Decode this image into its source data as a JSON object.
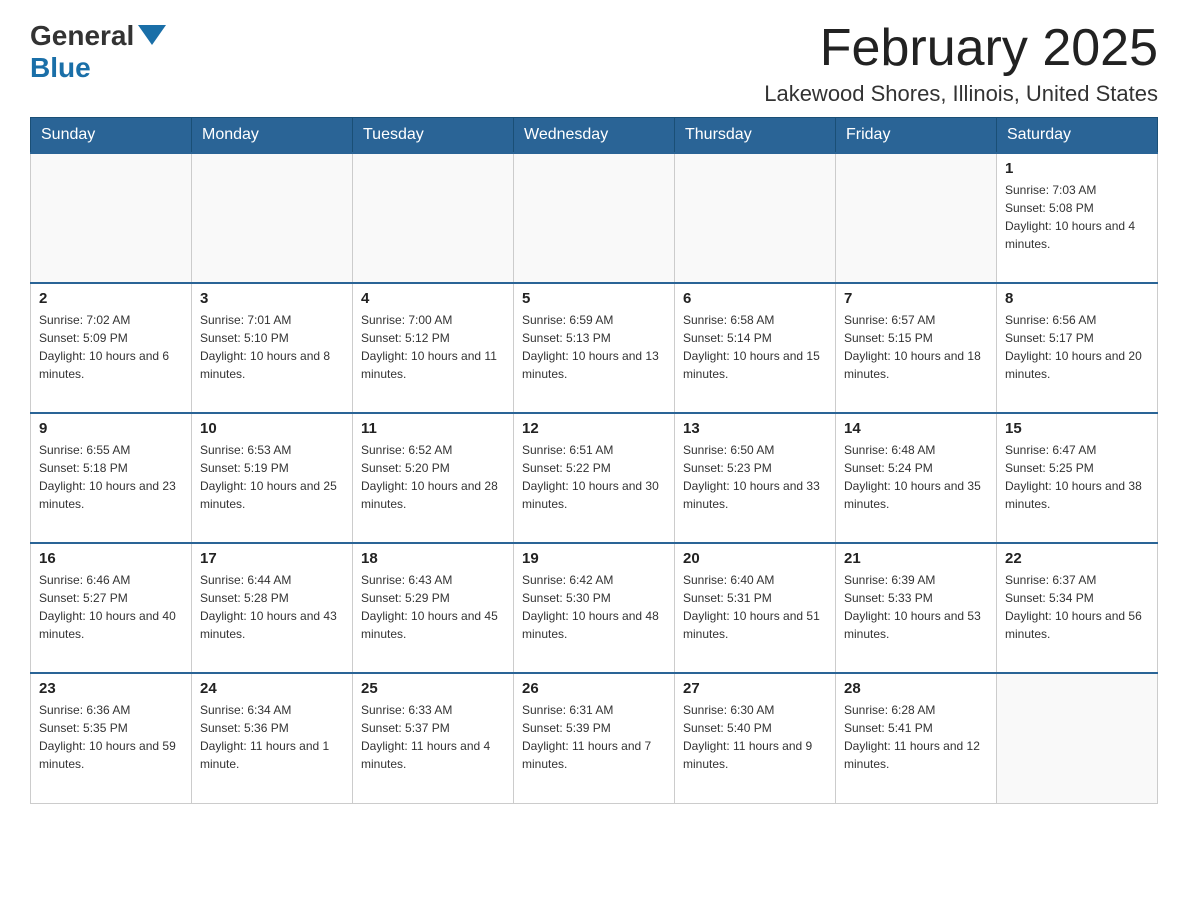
{
  "logo": {
    "text_general": "General",
    "text_blue": "Blue"
  },
  "title": "February 2025",
  "location": "Lakewood Shores, Illinois, United States",
  "days_of_week": [
    "Sunday",
    "Monday",
    "Tuesday",
    "Wednesday",
    "Thursday",
    "Friday",
    "Saturday"
  ],
  "weeks": [
    [
      {
        "day": "",
        "info": ""
      },
      {
        "day": "",
        "info": ""
      },
      {
        "day": "",
        "info": ""
      },
      {
        "day": "",
        "info": ""
      },
      {
        "day": "",
        "info": ""
      },
      {
        "day": "",
        "info": ""
      },
      {
        "day": "1",
        "info": "Sunrise: 7:03 AM\nSunset: 5:08 PM\nDaylight: 10 hours and 4 minutes."
      }
    ],
    [
      {
        "day": "2",
        "info": "Sunrise: 7:02 AM\nSunset: 5:09 PM\nDaylight: 10 hours and 6 minutes."
      },
      {
        "day": "3",
        "info": "Sunrise: 7:01 AM\nSunset: 5:10 PM\nDaylight: 10 hours and 8 minutes."
      },
      {
        "day": "4",
        "info": "Sunrise: 7:00 AM\nSunset: 5:12 PM\nDaylight: 10 hours and 11 minutes."
      },
      {
        "day": "5",
        "info": "Sunrise: 6:59 AM\nSunset: 5:13 PM\nDaylight: 10 hours and 13 minutes."
      },
      {
        "day": "6",
        "info": "Sunrise: 6:58 AM\nSunset: 5:14 PM\nDaylight: 10 hours and 15 minutes."
      },
      {
        "day": "7",
        "info": "Sunrise: 6:57 AM\nSunset: 5:15 PM\nDaylight: 10 hours and 18 minutes."
      },
      {
        "day": "8",
        "info": "Sunrise: 6:56 AM\nSunset: 5:17 PM\nDaylight: 10 hours and 20 minutes."
      }
    ],
    [
      {
        "day": "9",
        "info": "Sunrise: 6:55 AM\nSunset: 5:18 PM\nDaylight: 10 hours and 23 minutes."
      },
      {
        "day": "10",
        "info": "Sunrise: 6:53 AM\nSunset: 5:19 PM\nDaylight: 10 hours and 25 minutes."
      },
      {
        "day": "11",
        "info": "Sunrise: 6:52 AM\nSunset: 5:20 PM\nDaylight: 10 hours and 28 minutes."
      },
      {
        "day": "12",
        "info": "Sunrise: 6:51 AM\nSunset: 5:22 PM\nDaylight: 10 hours and 30 minutes."
      },
      {
        "day": "13",
        "info": "Sunrise: 6:50 AM\nSunset: 5:23 PM\nDaylight: 10 hours and 33 minutes."
      },
      {
        "day": "14",
        "info": "Sunrise: 6:48 AM\nSunset: 5:24 PM\nDaylight: 10 hours and 35 minutes."
      },
      {
        "day": "15",
        "info": "Sunrise: 6:47 AM\nSunset: 5:25 PM\nDaylight: 10 hours and 38 minutes."
      }
    ],
    [
      {
        "day": "16",
        "info": "Sunrise: 6:46 AM\nSunset: 5:27 PM\nDaylight: 10 hours and 40 minutes."
      },
      {
        "day": "17",
        "info": "Sunrise: 6:44 AM\nSunset: 5:28 PM\nDaylight: 10 hours and 43 minutes."
      },
      {
        "day": "18",
        "info": "Sunrise: 6:43 AM\nSunset: 5:29 PM\nDaylight: 10 hours and 45 minutes."
      },
      {
        "day": "19",
        "info": "Sunrise: 6:42 AM\nSunset: 5:30 PM\nDaylight: 10 hours and 48 minutes."
      },
      {
        "day": "20",
        "info": "Sunrise: 6:40 AM\nSunset: 5:31 PM\nDaylight: 10 hours and 51 minutes."
      },
      {
        "day": "21",
        "info": "Sunrise: 6:39 AM\nSunset: 5:33 PM\nDaylight: 10 hours and 53 minutes."
      },
      {
        "day": "22",
        "info": "Sunrise: 6:37 AM\nSunset: 5:34 PM\nDaylight: 10 hours and 56 minutes."
      }
    ],
    [
      {
        "day": "23",
        "info": "Sunrise: 6:36 AM\nSunset: 5:35 PM\nDaylight: 10 hours and 59 minutes."
      },
      {
        "day": "24",
        "info": "Sunrise: 6:34 AM\nSunset: 5:36 PM\nDaylight: 11 hours and 1 minute."
      },
      {
        "day": "25",
        "info": "Sunrise: 6:33 AM\nSunset: 5:37 PM\nDaylight: 11 hours and 4 minutes."
      },
      {
        "day": "26",
        "info": "Sunrise: 6:31 AM\nSunset: 5:39 PM\nDaylight: 11 hours and 7 minutes."
      },
      {
        "day": "27",
        "info": "Sunrise: 6:30 AM\nSunset: 5:40 PM\nDaylight: 11 hours and 9 minutes."
      },
      {
        "day": "28",
        "info": "Sunrise: 6:28 AM\nSunset: 5:41 PM\nDaylight: 11 hours and 12 minutes."
      },
      {
        "day": "",
        "info": ""
      }
    ]
  ]
}
